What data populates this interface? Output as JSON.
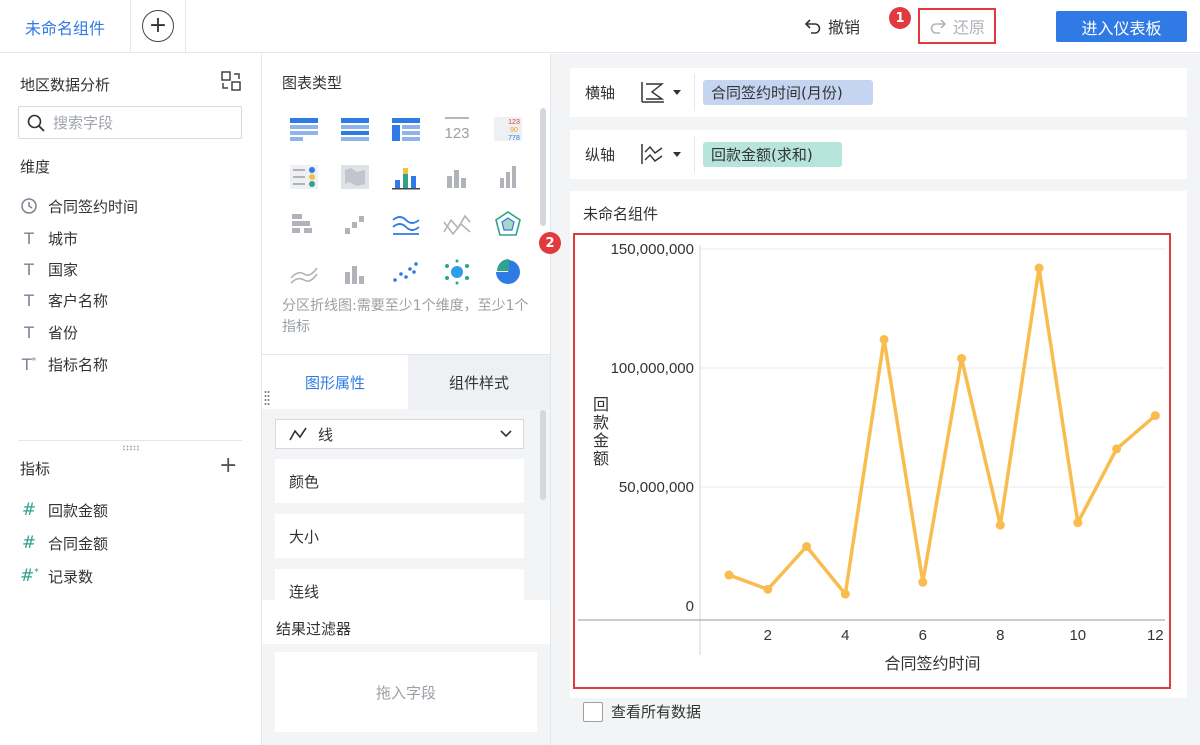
{
  "topbar": {
    "tab_label": "未命名组件",
    "undo_label": "撤销",
    "redo_label": "还原",
    "dashboard_button": "进入仪表板",
    "marker_1": "1",
    "marker_2": "2"
  },
  "left_panel": {
    "dataset_title": "地区数据分析",
    "search_placeholder": "搜索字段",
    "dimensions_title": "维度",
    "dimensions": [
      {
        "icon": "clock-icon",
        "label": "合同签约时间"
      },
      {
        "icon": "text-type-icon",
        "label": "城市"
      },
      {
        "icon": "text-type-icon",
        "label": "国家"
      },
      {
        "icon": "text-type-icon",
        "label": "客户名称"
      },
      {
        "icon": "text-type-icon",
        "label": "省份"
      },
      {
        "icon": "text-type-calc-icon",
        "label": "指标名称"
      }
    ],
    "measures_title": "指标",
    "measures": [
      {
        "icon": "hash-icon",
        "label": "回款金额"
      },
      {
        "icon": "hash-icon",
        "label": "合同金额"
      },
      {
        "icon": "hash-calc-icon",
        "label": "记录数"
      }
    ]
  },
  "mid_panel": {
    "chart_types_title": "图表类型",
    "chart_hint": "分区折线图:需要至少1个维度，至少1个指标",
    "tab_attr": "图形属性",
    "tab_style": "组件样式",
    "line_type": "线",
    "props": [
      "颜色",
      "大小",
      "连线"
    ],
    "filter_title": "结果过滤器",
    "filter_drop": "拖入字段"
  },
  "right_area": {
    "x_axis_label": "横轴",
    "x_axis_field": "合同签约时间(月份)",
    "y_axis_label": "纵轴",
    "y_axis_field": "回款金额(求和)",
    "chart_name": "未命名组件",
    "view_all": "查看所有数据"
  },
  "colors": {
    "accent": "#2f7ae5",
    "highlight_red": "#e0393e",
    "line": "#f9bd4f",
    "x_pill": "#c5d4f1",
    "y_pill": "#b7e5dc"
  },
  "chart_data": {
    "type": "line",
    "x": [
      1,
      2,
      3,
      4,
      5,
      6,
      7,
      8,
      9,
      10,
      11,
      12
    ],
    "series": [
      {
        "values": [
          13000000,
          7000000,
          25000000,
          5000000,
          112000000,
          10000000,
          104000000,
          34000000,
          142000000,
          35000000,
          66000000,
          80000000
        ]
      }
    ],
    "xlabel": "合同签约时间",
    "ylabel": "回款金额",
    "xticks": [
      "2",
      "4",
      "6",
      "8",
      "10",
      "12"
    ],
    "xtick_values": [
      2,
      4,
      6,
      8,
      10,
      12
    ],
    "yticks": [
      "0",
      "50,000,000",
      "100,000,000",
      "150,000,000"
    ],
    "ytick_values": [
      0,
      50000000,
      100000000,
      150000000
    ],
    "ylim": [
      0,
      150000000
    ],
    "xlim": [
      0.25,
      12.25
    ],
    "grid": true
  }
}
